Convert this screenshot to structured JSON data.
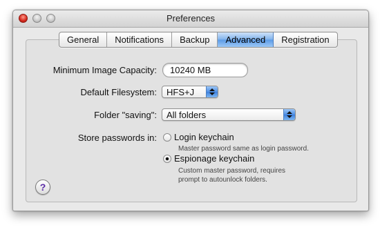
{
  "window": {
    "title": "Preferences"
  },
  "tabs": [
    {
      "label": "General"
    },
    {
      "label": "Notifications"
    },
    {
      "label": "Backup"
    },
    {
      "label": "Advanced",
      "active": true
    },
    {
      "label": "Registration"
    }
  ],
  "form": {
    "min_capacity_label": "Minimum Image Capacity:",
    "min_capacity_value": "10240 MB",
    "filesystem_label": "Default Filesystem:",
    "filesystem_value": "HFS+J",
    "folder_saving_label": "Folder \"saving\":",
    "folder_saving_value": "All folders",
    "store_passwords_label": "Store passwords in:",
    "login_keychain_label": "Login keychain",
    "login_keychain_note": "Master password same as login password.",
    "espionage_keychain_label": "Espionage keychain",
    "espionage_keychain_note_1": "Custom master password, requires",
    "espionage_keychain_note_2": "prompt to autounlock folders.",
    "selected_option": "espionage_keychain"
  },
  "help": {
    "symbol": "?"
  },
  "colors": {
    "accent": "#5b9ae6",
    "help_glyph": "#5a2aa6"
  },
  "icons": [
    "close-icon",
    "minimize-icon",
    "zoom-icon",
    "help-icon",
    "stepper-icon",
    "radio-icon"
  ]
}
